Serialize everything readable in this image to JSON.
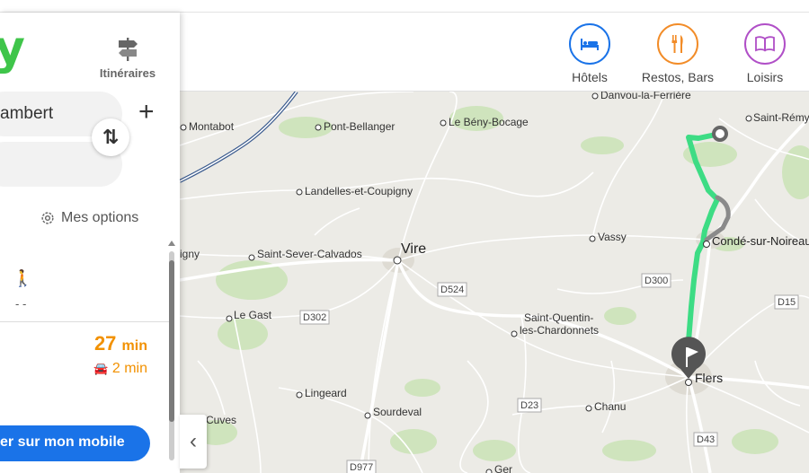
{
  "brand": {
    "logo_text": "y",
    "logo_color": "#3fc54a"
  },
  "sidebar": {
    "itinerary_label": "Itinéraires",
    "from_value": "ambert",
    "add_label": "+",
    "swap_label": "⇅",
    "options_label": "Mes options",
    "walk_icon": "🚶",
    "walk_value": "- -",
    "duration_value": "27",
    "duration_unit": "min",
    "car_icon": "🚘",
    "car_detail": "2 min",
    "mobile_button_label": "er sur mon mobile"
  },
  "header": {
    "categories": [
      {
        "label": "Hôtels",
        "icon": "bed-icon",
        "color": "#1a73e8"
      },
      {
        "label": "Restos, Bars",
        "icon": "cutlery-icon",
        "color": "#f28c28"
      },
      {
        "label": "Loisirs",
        "icon": "book-icon",
        "color": "#b04fc7"
      }
    ]
  },
  "map": {
    "route_color": "#3ddc84",
    "places": [
      {
        "name": "Danvou-la-Ferrière"
      },
      {
        "name": "Saint-Rémy"
      },
      {
        "name": "Montabot"
      },
      {
        "name": "Pont-Bellanger"
      },
      {
        "name": "Le Bény-Bocage"
      },
      {
        "name": "Landelles-et-Coupigny"
      },
      {
        "name": "igny"
      },
      {
        "name": "Saint-Sever-Calvados"
      },
      {
        "name": "Vire"
      },
      {
        "name": "Vassy"
      },
      {
        "name": "Condé-sur-Noireau"
      },
      {
        "name": "Le Gast"
      },
      {
        "name": "Saint-Quentin-"
      },
      {
        "name": "les-Chardonnets"
      },
      {
        "name": "Flers"
      },
      {
        "name": "Lingeard"
      },
      {
        "name": "Sourdeval"
      },
      {
        "name": "Chanu"
      },
      {
        "name": "Cuves"
      },
      {
        "name": "Ger"
      }
    ],
    "road_labels": [
      "D524",
      "D300",
      "D302",
      "D15",
      "D23",
      "D43",
      "D977"
    ]
  },
  "collapse_label": "‹"
}
